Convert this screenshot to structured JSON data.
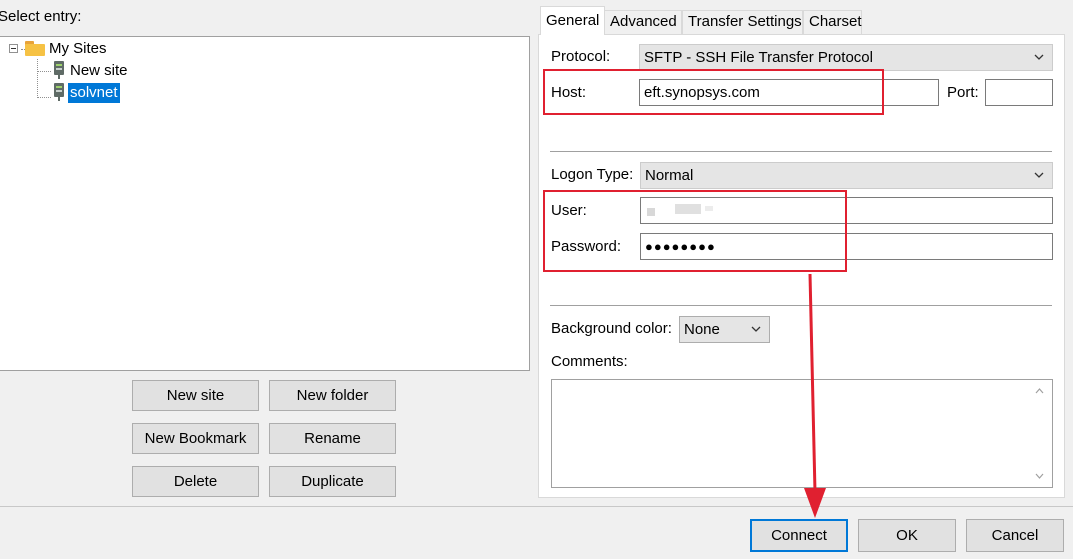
{
  "left": {
    "select_entry_label": "Select entry:",
    "tree": {
      "root": "My Sites",
      "items": [
        "New site",
        "solvnet"
      ],
      "selected": "solvnet"
    },
    "buttons": {
      "new_site": "New site",
      "new_folder": "New folder",
      "new_bookmark": "New Bookmark",
      "rename": "Rename",
      "delete": "Delete",
      "duplicate": "Duplicate"
    }
  },
  "tabs": [
    "General",
    "Advanced",
    "Transfer Settings",
    "Charset"
  ],
  "active_tab": "General",
  "general": {
    "protocol_label": "Protocol:",
    "protocol_value": "SFTP - SSH File Transfer Protocol",
    "host_label": "Host:",
    "host_value": "eft.synopsys.com",
    "port_label": "Port:",
    "port_value": "",
    "logon_type_label": "Logon Type:",
    "logon_type_value": "Normal",
    "user_label": "User:",
    "user_value": "",
    "password_label": "Password:",
    "password_value": "●●●●●●●●",
    "background_color_label": "Background color:",
    "background_color_value": "None",
    "comments_label": "Comments:",
    "comments_value": ""
  },
  "footer": {
    "connect": "Connect",
    "ok": "OK",
    "cancel": "Cancel"
  },
  "colors": {
    "accent": "#0078d7",
    "annotation": "#e02030"
  }
}
